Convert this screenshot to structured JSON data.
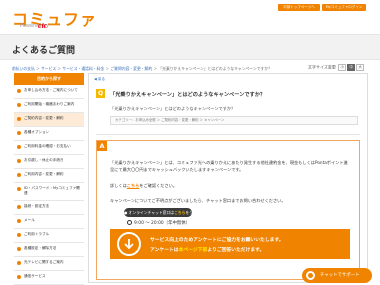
{
  "header": {
    "logo": "コミュファ",
    "logo_sub": "Powered by",
    "logo_brand": "ctc",
    "btn_top": "中部トップページへ",
    "btn_mypage": "Myコミュファログイン"
  },
  "page_title": "よくあるご質問",
  "breadcrumb": {
    "items": [
      "前払いの支払",
      "サービス",
      "サービス・通話料・料金",
      "ご質問内容・変更・解約",
      "「光乗りかえキャンペーン」とはどのようなキャンペーンですか？"
    ],
    "sep": " ＞ "
  },
  "font_size": {
    "label": "文字サイズ変更",
    "small": "小",
    "medium": "中",
    "large": "大"
  },
  "sidebar": {
    "heading": "目的から探す",
    "items": [
      "お申し込み方法・ご案内について",
      "ご利用開始・機器まわりご案内",
      "ご契約内容・変更・解約",
      "各種オプション",
      "ご利用料金の確認・お支払い",
      "お引越し・休止の手続き",
      "ご利用内容・変更・解約",
      "ID・パスワード・Myコミュファ関連",
      "接続・設定方法",
      "メール",
      "ご利用トラブル",
      "各種設定・解除方法",
      "光テレビに関するご案内",
      "通信サービス"
    ]
  },
  "panel": {
    "back": "◀ 戻る",
    "q_badge": "Q",
    "q_title": "「光乗りかえキャンペーン」とはどのようなキャンペーンですか？",
    "q_sub": "「光乗りかえキャンペーン」とはどのようなキャンペーンですか？",
    "category": "カテゴリー：お申込み全般 ＞ ご契約内容・変更・解約 ＞ キャンペーン",
    "a_badge": "A",
    "a_text": "「光乗りかえキャンペーン」とは、コミュファ光への乗りかえにあたり発生する他社違約金を、現金もしくはPontaポイント進呈にて最大〇〇円までキャッシュバックいたしますキャンペーンです。",
    "a_detail_prefix": "詳しくは",
    "a_detail_link": "こちら",
    "a_detail_suffix": "をご確認ください。",
    "a_chat": "キャンペーンについてご不明点がございましたら、チャット窓口までお問い合わせください。",
    "chat_btn_prefix": "オンラインチャット窓口は",
    "chat_btn_link": "こちら",
    "chat_btn_suffix": "をクリック",
    "hours": "9:00 ～ 20:00（年中無休）",
    "survey_l1": "サービス向上のためアンケートにご協力をお願いいたします。",
    "survey_l2_a": "アンケートは",
    "survey_l2_b": "本ページ下部",
    "survey_l2_c": "よりご回答いただけます。"
  },
  "float_chat": {
    "label": "チャットでサポート"
  },
  "colors": {
    "brand": "#f08300",
    "accent_yellow": "#f5b800",
    "link": "#3a6fb7"
  }
}
